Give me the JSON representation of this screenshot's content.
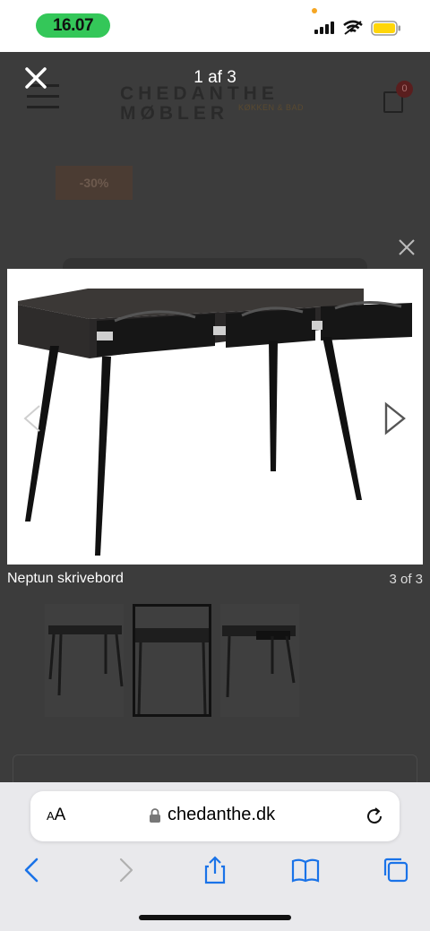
{
  "status_bar": {
    "time": "16.07",
    "icons": [
      "signal-icon",
      "wifi-icon",
      "battery-icon"
    ],
    "pill_color": "#34c759",
    "battery_color": "#ffd60a"
  },
  "site": {
    "logo_main_line1": "CHEDANTHE",
    "logo_main_line2": "MØBLER",
    "logo_sub": "KØKKEN & BAD",
    "cart_count": "0",
    "discount_badge": "-30%"
  },
  "lightbox": {
    "counter_top": "1 af 3",
    "caption": "Neptun skrivebord",
    "counter_bottom": "3 of 3",
    "close_icon": "close-icon",
    "prev_icon": "chevron-left-icon",
    "next_icon": "chevron-right-icon"
  },
  "browser": {
    "text_size_label_small": "A",
    "text_size_label_large": "A",
    "url": "chedanthe.dk",
    "nav_icons": [
      "back-icon",
      "forward-icon",
      "share-icon",
      "bookmarks-icon",
      "tabs-icon"
    ],
    "accent": "#1a73e8"
  }
}
